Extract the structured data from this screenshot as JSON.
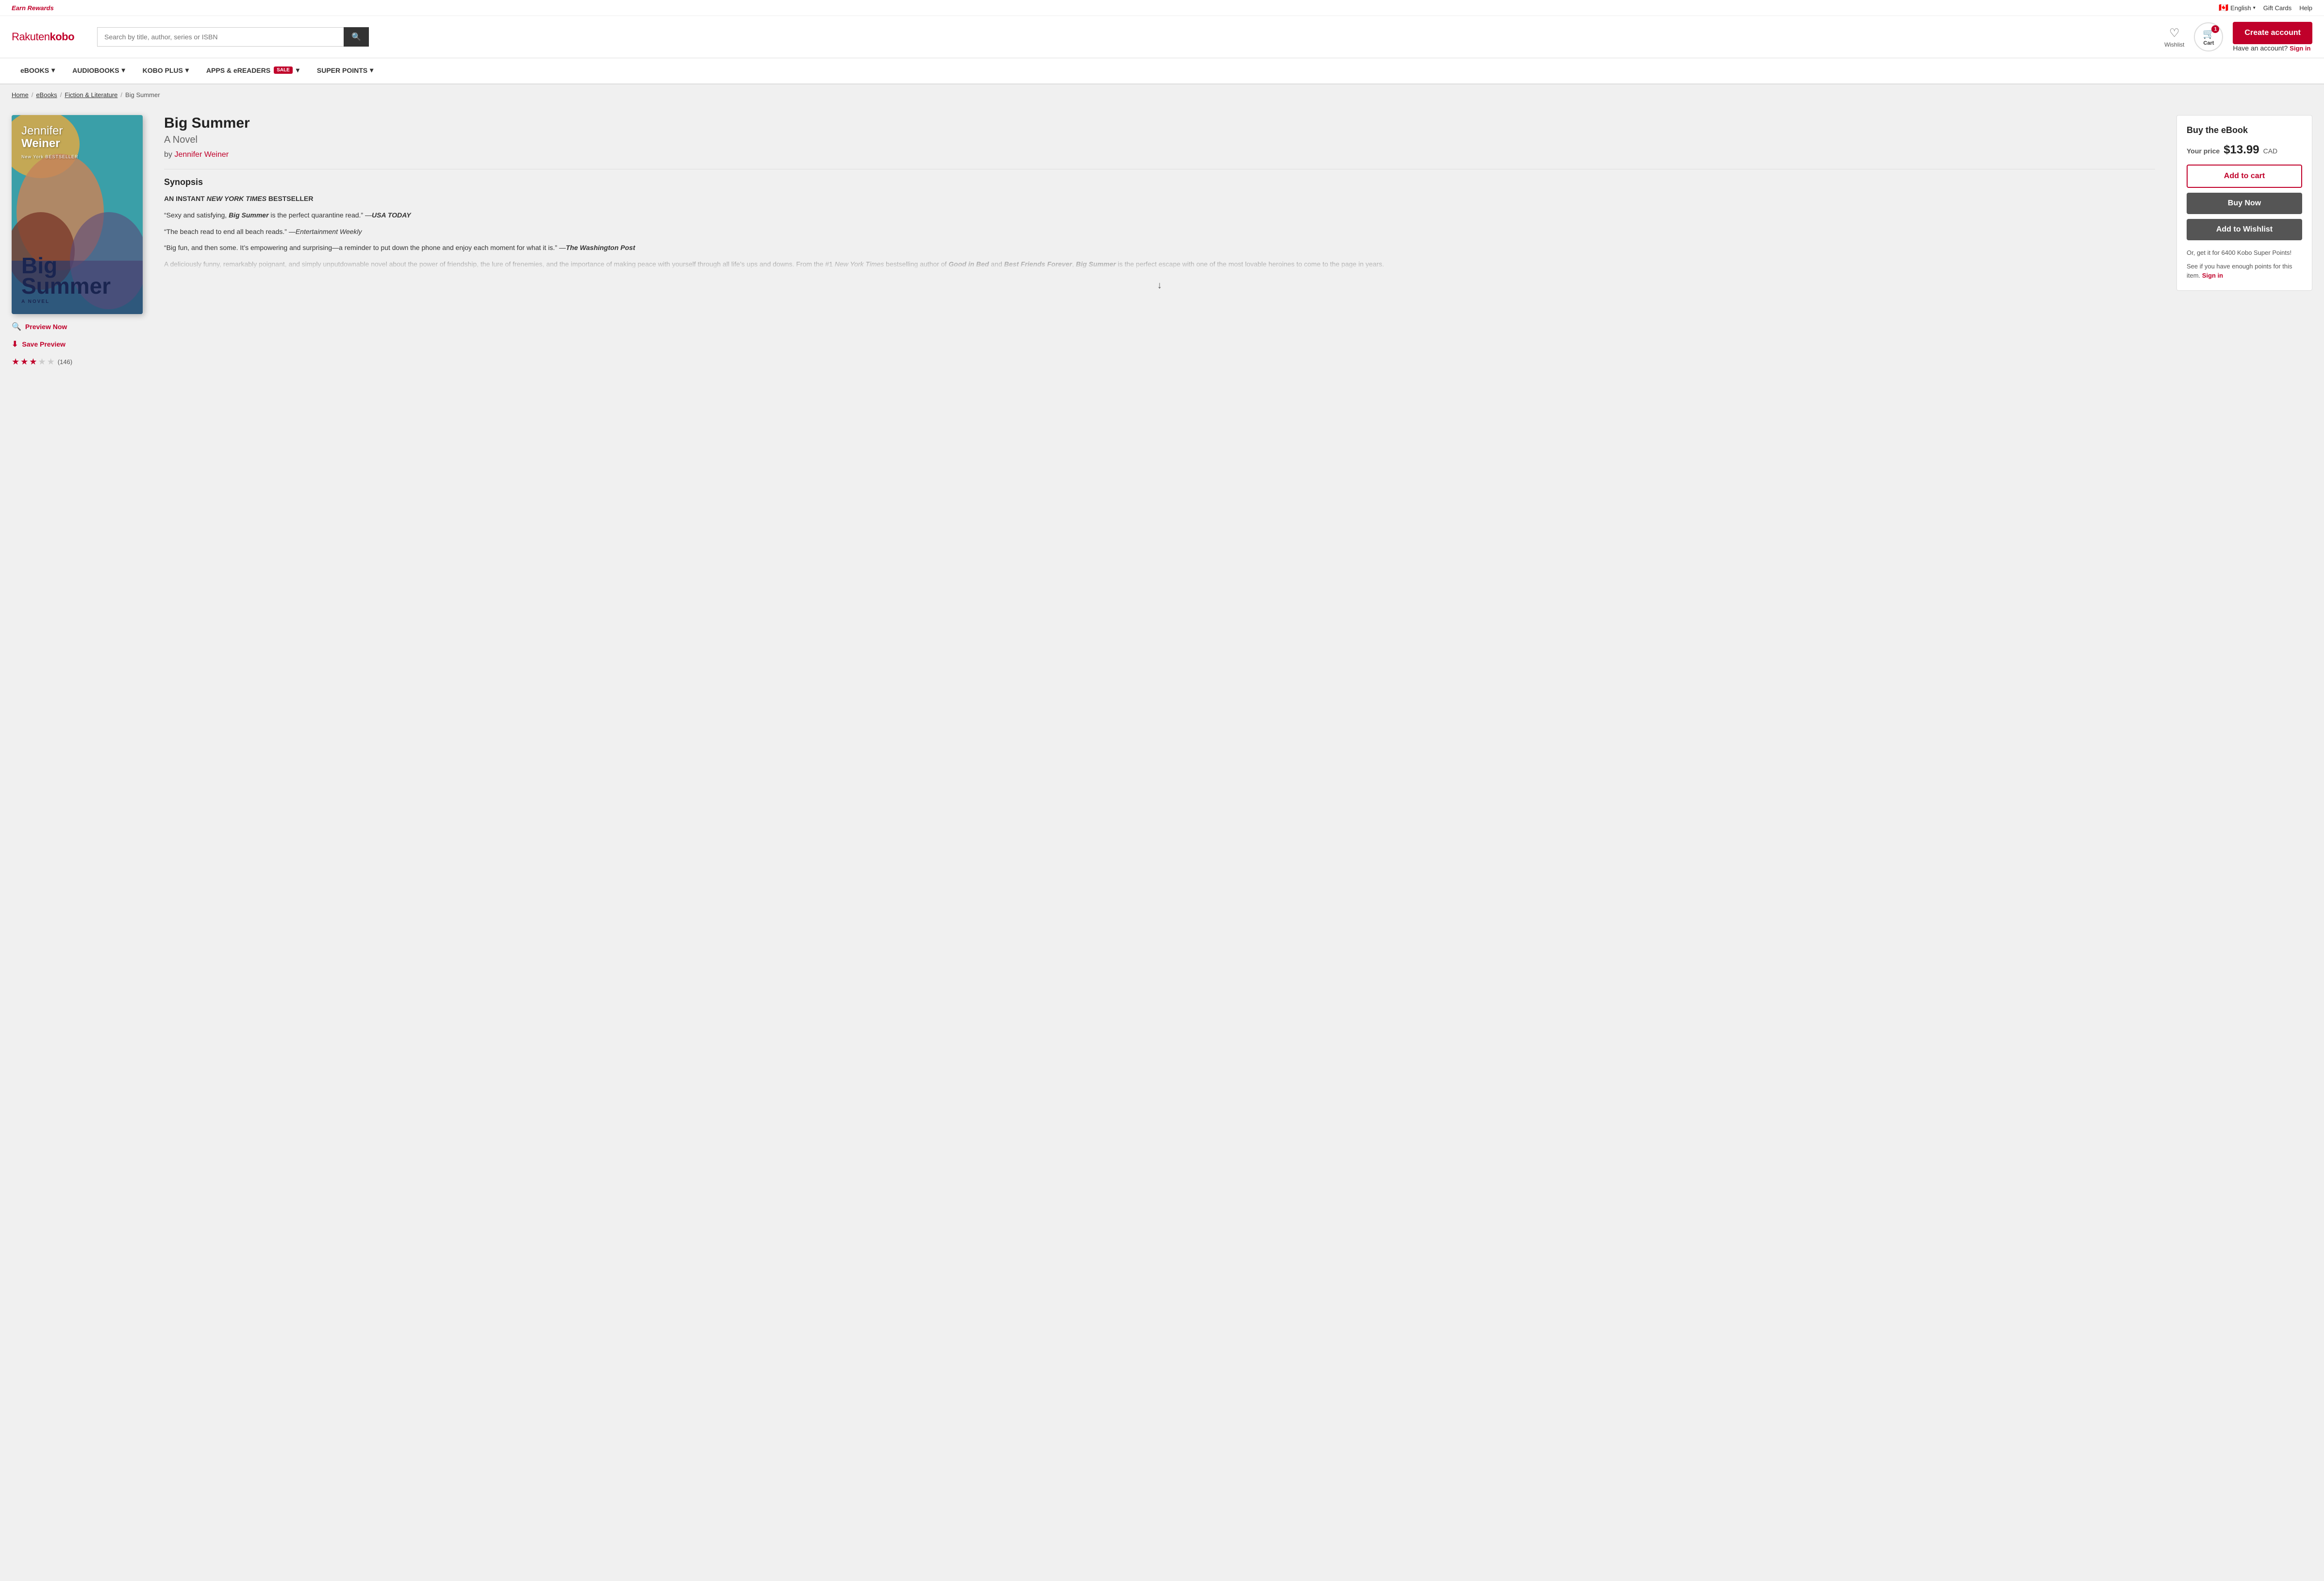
{
  "topbar": {
    "earn_rewards": "Earn Rewards",
    "language": "English",
    "gift_cards": "Gift Cards",
    "help": "Help"
  },
  "header": {
    "logo_rakuten": "Rakuten",
    "logo_kobo": "kobo",
    "search_placeholder": "Search by title, author, series or ISBN",
    "wishlist_label": "Wishlist",
    "cart_label": "Cart",
    "cart_count": "1",
    "create_account": "Create account",
    "have_account": "Have an account?",
    "sign_in": "Sign in"
  },
  "nav": {
    "items": [
      {
        "label": "eBOOKS",
        "has_dropdown": true
      },
      {
        "label": "AUDIOBOOKS",
        "has_dropdown": true
      },
      {
        "label": "KOBO PLUS",
        "has_dropdown": true
      },
      {
        "label": "APPS & eREADERS",
        "has_badge": true,
        "badge": "SALE",
        "has_dropdown": true
      },
      {
        "label": "SUPER POINTS",
        "has_dropdown": true
      }
    ]
  },
  "breadcrumb": {
    "home": "Home",
    "ebooks": "eBooks",
    "category": "Fiction & Literature",
    "current": "Big Summer"
  },
  "book": {
    "title": "Big Summer",
    "subtitle": "A Novel",
    "author": "Jennifer Weiner",
    "synopsis_title": "Synopsis",
    "cover_author_first": "Jennifer",
    "cover_author_last": "Weiner",
    "cover_bestseller": "New York BESTSELLER",
    "cover_title": "Big",
    "cover_title2": "Summer",
    "cover_subtitle": "A NOVEL",
    "synopsis_headline": "AN INSTANT NEW YORK TIMES BESTSELLER",
    "synopsis_quote1": "“Sexy and satisfying, Big Summer is the perfect quarantine read.” —USA TODAY",
    "synopsis_quote2": "“The beach read to end all beach reads.” —Entertainment Weekly",
    "synopsis_quote3": "“Big fun, and then some. It’s empowering and surprising—a reminder to put down the phone and enjoy each moment for what it is.” —The Washington Post",
    "synopsis_body": "A deliciously funny, remarkably poignant, and simply unputdownable novel about the power of friendship, the lure of frenemies, and the importance of making peace with yourself through all life’s ups and downs. From the #1 New York Times bestselling author of Good in Bed and Best Friends Forever, Big Summer is the perfect escape with one of the most lovable heroines to come to the page in years.",
    "preview_now": "Preview Now",
    "save_preview": "Save Preview",
    "rating": "3.5",
    "rating_count": "(146)",
    "stars": [
      true,
      true,
      true,
      true,
      false
    ]
  },
  "buy_box": {
    "title": "Buy the eBook",
    "price_label": "Your price",
    "price": "$13.99",
    "currency": "CAD",
    "add_to_cart": "Add to cart",
    "buy_now": "Buy Now",
    "add_wishlist": "Add to Wishlist",
    "kobo_points_text": "Or, get it for 6400 Kobo Super Points!",
    "kobo_points_detail": "See if you have enough points for this item.",
    "sign_in": "Sign in"
  }
}
